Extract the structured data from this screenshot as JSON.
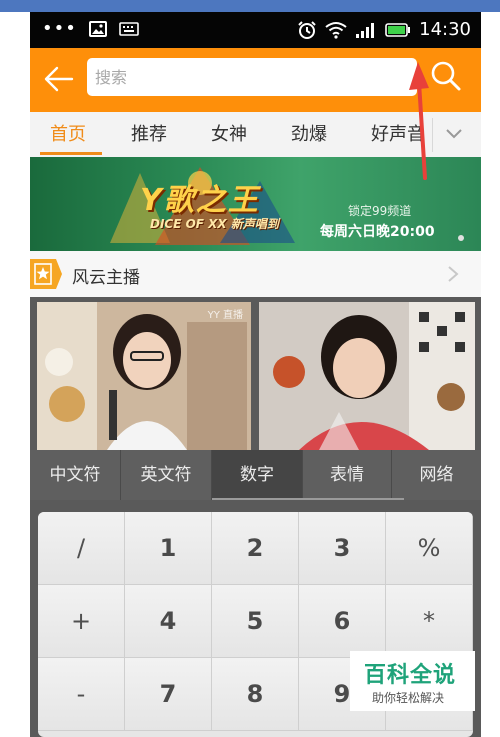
{
  "status_bar": {
    "dots": "•••",
    "time": "14:30"
  },
  "header": {
    "search_placeholder": "搜索"
  },
  "tabs": [
    {
      "label": "首页"
    },
    {
      "label": "推荐"
    },
    {
      "label": "女神"
    },
    {
      "label": "劲爆"
    },
    {
      "label": "好声音"
    }
  ],
  "banner": {
    "title": "Y歌之王",
    "subtitle": "DICE OF XX 新声唱到",
    "channel_text": "锁定99频道",
    "schedule_text": "每周六日晚20:00"
  },
  "section": {
    "title": "风云主播"
  },
  "thumbnails": [
    {
      "tag": "YY 直播"
    },
    {
      "tag": ""
    }
  ],
  "keyboard": {
    "tabs": [
      {
        "label": "中文符"
      },
      {
        "label": "英文符"
      },
      {
        "label": "数字"
      },
      {
        "label": "表情"
      },
      {
        "label": "网络"
      }
    ],
    "active_tab": "数字",
    "keys": [
      [
        "/",
        "1",
        "2",
        "3",
        "%"
      ],
      [
        "+",
        "4",
        "5",
        "6",
        "*"
      ],
      [
        "-",
        "7",
        "8",
        "9",
        ""
      ]
    ]
  },
  "watermark": {
    "title": "百科全说",
    "subtitle": "助你轻松解决"
  },
  "colors": {
    "accent_orange": "#fe8f0a",
    "tab_active": "#f08c1a",
    "annotation_red": "#e8413a",
    "watermark_green": "#1fa37a"
  }
}
